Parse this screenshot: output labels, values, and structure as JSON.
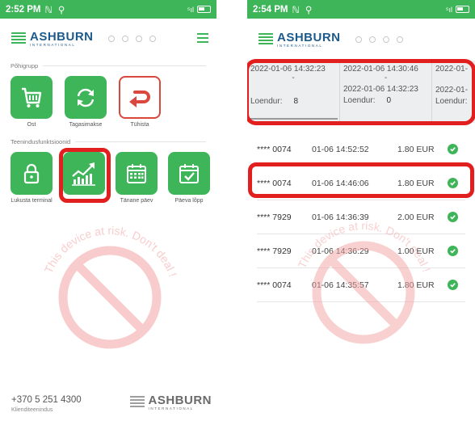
{
  "left": {
    "status": {
      "time": "2:52 PM",
      "signal": "⁵ıl"
    },
    "brand": {
      "name": "ASHBURN",
      "tagline": "INTERNATIONAL"
    },
    "sections": [
      {
        "label": "Põhigrupp",
        "tiles": [
          {
            "icon": "cart-icon",
            "label": "Ost"
          },
          {
            "icon": "refund-icon",
            "label": "Tagasimakse"
          },
          {
            "icon": "cancel-icon",
            "label": "Tühista"
          }
        ]
      },
      {
        "label": "Teenindusfunktsioonid",
        "tiles": [
          {
            "icon": "lock-icon",
            "label": "Lukusta terminal"
          },
          {
            "icon": "chart-icon",
            "label": ""
          },
          {
            "icon": "calendar-icon",
            "label": "Tänane päev"
          },
          {
            "icon": "calendar-check-icon",
            "label": "Päeva lõpp"
          }
        ]
      }
    ],
    "footer": {
      "phone": "+370 5 251 4300",
      "subtitle": "Klienditeenindus"
    },
    "watermark": "This device at risk. Don't deal !"
  },
  "right": {
    "status": {
      "time": "2:54 PM",
      "signal": "⁵ıl"
    },
    "brand": {
      "name": "ASHBURN",
      "tagline": "INTERNATIONAL"
    },
    "shifts": [
      {
        "from": "2022-01-06 14:32:23",
        "dash": "-",
        "to": "",
        "counter_label": "Loendur:",
        "count": "8"
      },
      {
        "from": "2022-01-06 14:30:46",
        "dash": "-",
        "to": "2022-01-06 14:32:23",
        "counter_label": "Loendur:",
        "count": "0"
      },
      {
        "from": "2022-01-",
        "dash": "",
        "to": "2022-01-",
        "counter_label": "Loendur:",
        "count": ""
      }
    ],
    "transactions": [
      {
        "card": "**** 0074",
        "datetime": "01-06 14:52:52",
        "amount": "1.80 EUR"
      },
      {
        "card": "**** 0074",
        "datetime": "01-06 14:46:06",
        "amount": "1.80 EUR"
      },
      {
        "card": "**** 7929",
        "datetime": "01-06 14:36:39",
        "amount": "2.00 EUR"
      },
      {
        "card": "**** 7929",
        "datetime": "01-06 14:36:29",
        "amount": "1.00 EUR"
      },
      {
        "card": "**** 0074",
        "datetime": "01-06 14:35:57",
        "amount": "1.80 EUR"
      }
    ],
    "watermark": "This device at risk. Don't deal !"
  },
  "colors": {
    "accent": "#3fb55a",
    "brand": "#1d5a8c",
    "highlight": "#e21f1f",
    "cancel": "#d9473f"
  }
}
